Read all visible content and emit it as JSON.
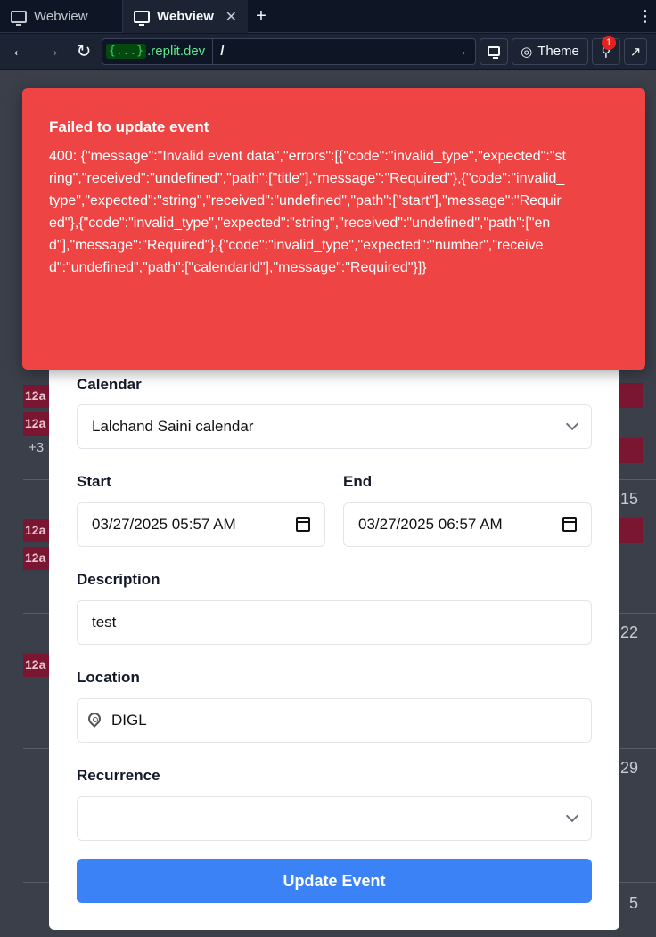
{
  "browser": {
    "tabs": [
      {
        "label": "Webview",
        "active": false
      },
      {
        "label": "Webview",
        "active": true
      }
    ],
    "url_badge": "{...}",
    "url_host": ".replit.dev",
    "url_path": "/",
    "theme_label": "Theme",
    "notification_count": "1"
  },
  "calendar_bg": {
    "event_label": "12a",
    "more_label": "+3",
    "day_numbers": [
      "15",
      "22",
      "29",
      "5"
    ]
  },
  "toast": {
    "title": "Failed to update event",
    "message": "400: {\"message\":\"Invalid event data\",\"errors\":[{\"code\":\"invalid_type\",\"expected\":\"string\",\"received\":\"undefined\",\"path\":[\"title\"],\"message\":\"Required\"},{\"code\":\"invalid_type\",\"expected\":\"string\",\"received\":\"undefined\",\"path\":[\"start\"],\"message\":\"Required\"},{\"code\":\"invalid_type\",\"expected\":\"string\",\"received\":\"undefined\",\"path\":[\"end\"],\"message\":\"Required\"},{\"code\":\"invalid_type\",\"expected\":\"number\",\"received\":\"undefined\",\"path\":[\"calendarId\"],\"message\":\"Required\"}]}"
  },
  "form": {
    "calendar_label": "Calendar",
    "calendar_value": "Lalchand Saini calendar",
    "start_label": "Start",
    "start_value": "03/27/2025 05:57 AM",
    "end_label": "End",
    "end_value": "03/27/2025 06:57 AM",
    "description_label": "Description",
    "description_value": "test",
    "location_label": "Location",
    "location_value": "DIGL",
    "recurrence_label": "Recurrence",
    "recurrence_value": "",
    "submit_label": "Update Event"
  }
}
